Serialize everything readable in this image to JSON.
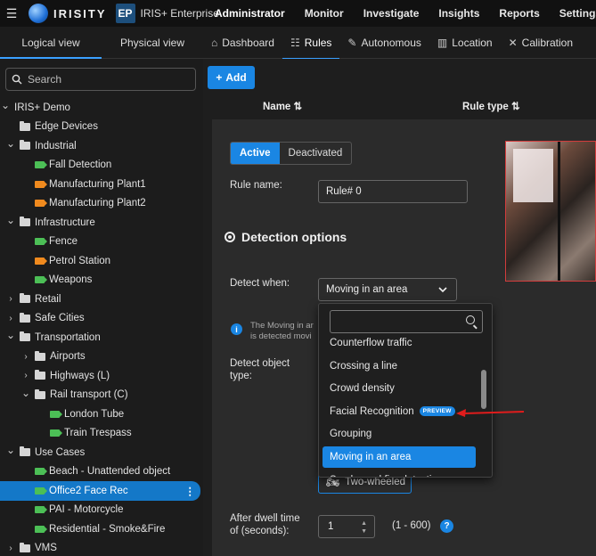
{
  "topbar": {
    "logo_text": "IRISITY",
    "env_badge": "EP",
    "env_name": "IRIS+ Enterprise",
    "nav": [
      "Administrator",
      "Monitor",
      "Investigate",
      "Insights",
      "Reports",
      "Settings"
    ]
  },
  "left_panel": {
    "tabs": [
      "Logical view",
      "Physical view"
    ],
    "search_placeholder": "Search",
    "tree": [
      {
        "label": "IRIS+ Demo",
        "type": "root",
        "level": 0,
        "chev": "down"
      },
      {
        "label": "Edge Devices",
        "type": "folder",
        "level": 1,
        "chev": "none"
      },
      {
        "label": "Industrial",
        "type": "folder",
        "level": 1,
        "chev": "down"
      },
      {
        "label": "Fall Detection",
        "type": "cam-green",
        "level": 2,
        "chev": "none"
      },
      {
        "label": "Manufacturing Plant1",
        "type": "cam-orange",
        "level": 2,
        "chev": "none"
      },
      {
        "label": "Manufacturing Plant2",
        "type": "cam-orange",
        "level": 2,
        "chev": "none"
      },
      {
        "label": "Infrastructure",
        "type": "folder",
        "level": 1,
        "chev": "down"
      },
      {
        "label": "Fence",
        "type": "cam-green",
        "level": 2,
        "chev": "none"
      },
      {
        "label": "Petrol Station",
        "type": "cam-orange",
        "level": 2,
        "chev": "none"
      },
      {
        "label": "Weapons",
        "type": "cam-green",
        "level": 2,
        "chev": "none"
      },
      {
        "label": "Retail",
        "type": "folder",
        "level": 1,
        "chev": "right"
      },
      {
        "label": "Safe Cities",
        "type": "folder",
        "level": 1,
        "chev": "right"
      },
      {
        "label": "Transportation",
        "type": "folder",
        "level": 1,
        "chev": "down"
      },
      {
        "label": "Airports",
        "type": "folder",
        "level": 2,
        "chev": "right"
      },
      {
        "label": "Highways (L)",
        "type": "folder",
        "level": 2,
        "chev": "right"
      },
      {
        "label": "Rail transport (C)",
        "type": "folder",
        "level": 2,
        "chev": "down"
      },
      {
        "label": "London Tube",
        "type": "cam-green",
        "level": 3,
        "chev": "none"
      },
      {
        "label": "Train Trespass",
        "type": "cam-green",
        "level": 3,
        "chev": "none"
      },
      {
        "label": "Use Cases",
        "type": "folder",
        "level": 1,
        "chev": "down"
      },
      {
        "label": "Beach - Unattended object",
        "type": "cam-green",
        "level": 2,
        "chev": "none"
      },
      {
        "label": "Office2 Face Rec",
        "type": "cam-green",
        "level": 2,
        "chev": "none",
        "selected": true
      },
      {
        "label": "PAI - Motorcycle",
        "type": "cam-green",
        "level": 2,
        "chev": "none"
      },
      {
        "label": "Residential - Smoke&Fire",
        "type": "cam-green",
        "level": 2,
        "chev": "none"
      },
      {
        "label": "VMS",
        "type": "folder",
        "level": 1,
        "chev": "right"
      }
    ]
  },
  "subnav": {
    "tabs": [
      {
        "label": "Dashboard",
        "icon": "home-icon"
      },
      {
        "label": "Rules",
        "icon": "list-icon",
        "active": true
      },
      {
        "label": "Autonomous",
        "icon": "pencil-icon"
      },
      {
        "label": "Location",
        "icon": "map-icon"
      },
      {
        "label": "Calibration",
        "icon": "wrench-icon"
      }
    ]
  },
  "toolbar": {
    "add_label": "Add",
    "col_name": "Name ⇅",
    "col_rule_type": "Rule type ⇅"
  },
  "form": {
    "status_active": "Active",
    "status_deactivated": "Deactivated",
    "rule_name_label": "Rule name:",
    "rule_name_value": "Rule# 0",
    "section_title": "Detection options",
    "detect_when_label": "Detect when:",
    "detect_when_value": "Moving in an area",
    "info_text": "The Moving in an area rule is detected movi",
    "info_text_line1": "The Moving in ar",
    "info_text_line2": "is detected movi",
    "detect_object_label_1": "Detect object",
    "detect_object_label_2": "type:",
    "two_wheeled_label": "Two-wheeled",
    "dwell_label_1": "After dwell time",
    "dwell_label_2": "of (seconds):",
    "dwell_value": "1",
    "dwell_range": "(1 - 600)",
    "help": "?"
  },
  "dropdown": {
    "items": [
      {
        "label": "Counterflow traffic"
      },
      {
        "label": "Crossing a line"
      },
      {
        "label": "Crowd density"
      },
      {
        "label": "Facial Recognition",
        "badge": "PREVIEW"
      },
      {
        "label": "Grouping"
      },
      {
        "label": "Moving in an area",
        "selected": true
      },
      {
        "label": "Smoke and fire detection"
      }
    ]
  },
  "colors": {
    "accent": "#1a86e3",
    "selected_tree": "#1478c8",
    "arrow": "#e01c1c",
    "cam_green": "#4cbf56",
    "cam_orange": "#f08a1e"
  }
}
